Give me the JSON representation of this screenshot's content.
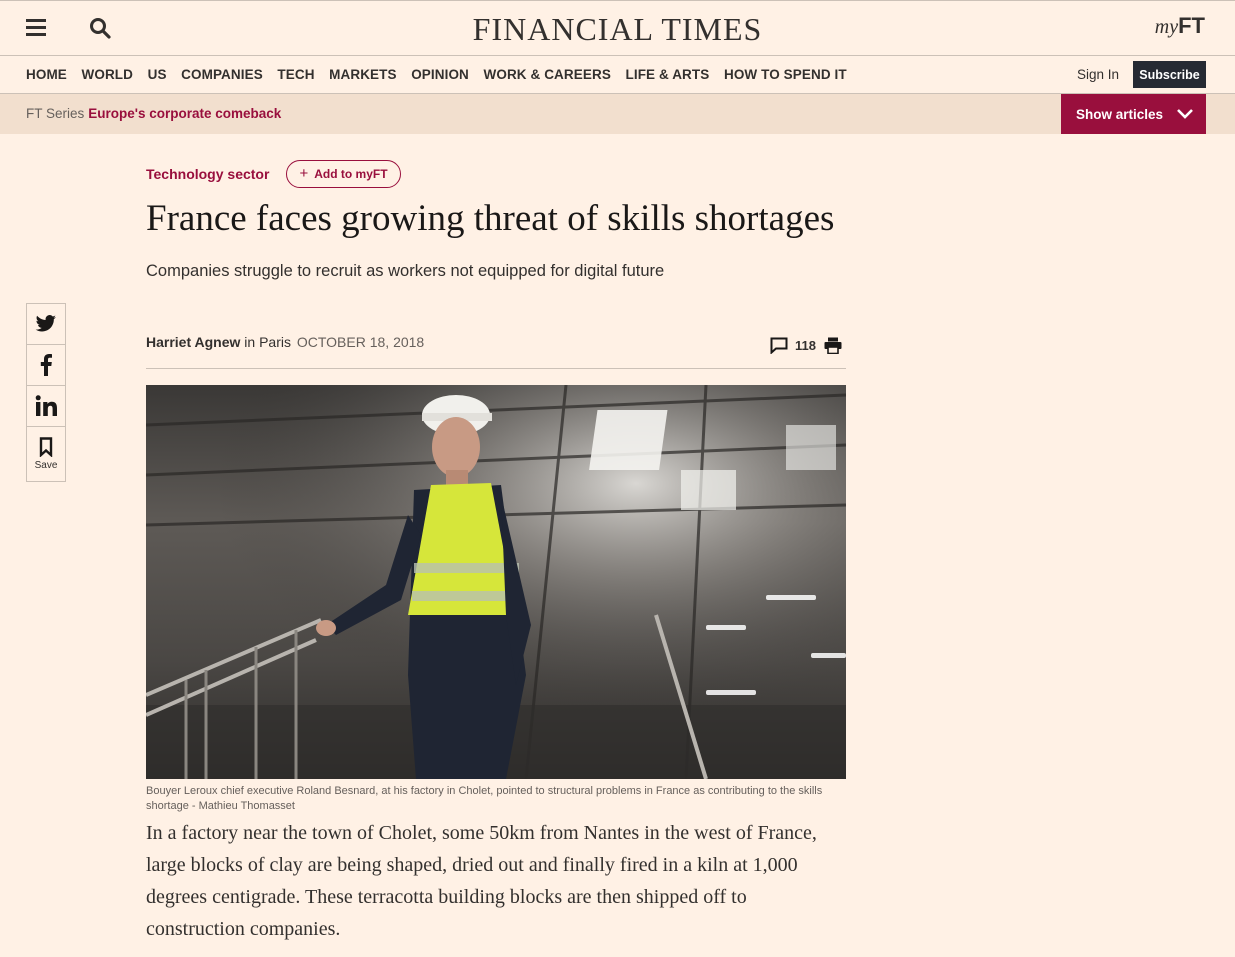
{
  "header": {
    "masthead": "FINANCIAL TIMES",
    "myft_prefix": "my",
    "myft_suffix": "FT"
  },
  "nav": {
    "items": [
      "HOME",
      "WORLD",
      "US",
      "COMPANIES",
      "TECH",
      "MARKETS",
      "OPINION",
      "WORK & CAREERS",
      "LIFE & ARTS",
      "HOW TO SPEND IT"
    ],
    "sign_in": "Sign In",
    "subscribe": "Subscribe"
  },
  "series": {
    "label": "FT Series",
    "title": "Europe's corporate comeback",
    "show_articles": "Show articles"
  },
  "share": {
    "save_label": "Save"
  },
  "article": {
    "topic": "Technology sector",
    "add_myft": "Add to myFT",
    "headline": "France faces growing threat of skills shortages",
    "standfirst": "Companies struggle to recruit as workers not equipped for digital future",
    "author": "Harriet Agnew",
    "location": "in Paris",
    "date": "OCTOBER 18, 2018",
    "comments_count": "118",
    "caption": "Bouyer Leroux chief executive Roland Besnard, at his factory in Cholet, pointed to structural problems in France as contributing to the skills shortage - Mathieu Thomasset",
    "body": "In a factory near the town of Cholet, some 50km from Nantes in the west of France, large blocks of clay are being shaped, dried out and finally fired in a kiln at 1,000 degrees centigrade. These terracotta building blocks are then shipped off to construction companies."
  },
  "colors": {
    "page_bg": "#fff1e5",
    "accent": "#990f3d",
    "subscribe_bg": "#262a33",
    "series_bg": "#f2dfce"
  }
}
